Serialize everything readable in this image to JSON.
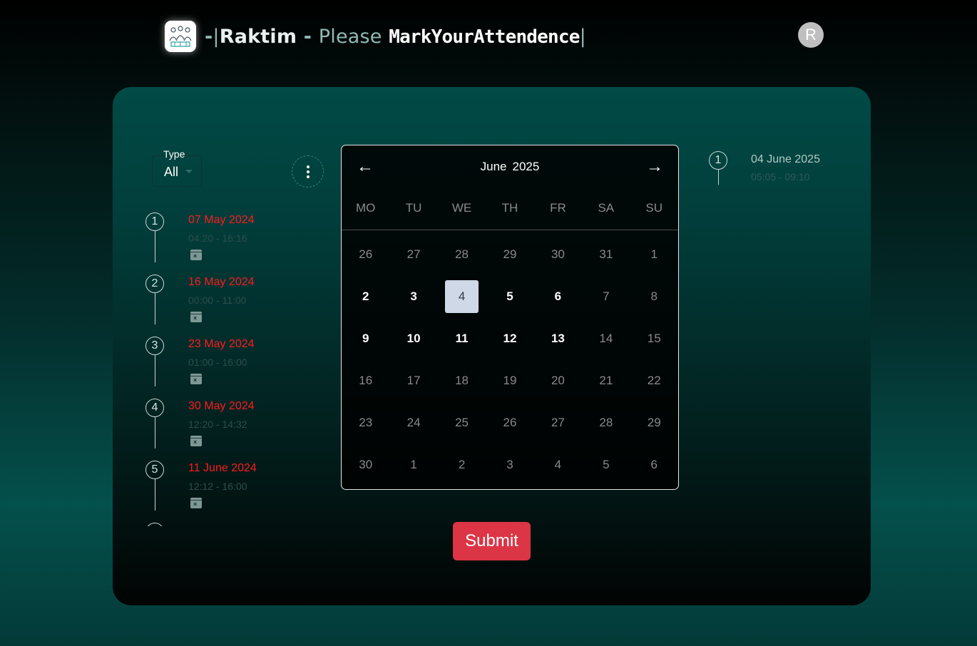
{
  "header": {
    "logo_icon": "team-attendance-icon",
    "title_dash": "-",
    "title_bar_open": "|",
    "user_name": "Raktim",
    "separator": " - ",
    "please": "Please",
    "mark": "MarkYourAttendence",
    "title_bar_close": "|",
    "avatar_initial": "R"
  },
  "filter": {
    "label": "Type",
    "value": "All",
    "caret_icon": "caret-down-icon",
    "more_icon": "vertical-dots-icon"
  },
  "timeline": [
    {
      "index": "1",
      "date": "07 May 2024",
      "time": "04:20 - 16:16",
      "icon": "calendar-x-icon"
    },
    {
      "index": "2",
      "date": "16 May 2024",
      "time": "00:00 - 11:00",
      "icon": "calendar-x-icon"
    },
    {
      "index": "3",
      "date": "23 May 2024",
      "time": "01:00 - 16:00",
      "icon": "calendar-x-icon"
    },
    {
      "index": "4",
      "date": "30 May 2024",
      "time": "12:20 - 14:32",
      "icon": "calendar-x-icon"
    },
    {
      "index": "5",
      "date": "11 June 2024",
      "time": "12:12 - 16:00",
      "icon": "calendar-x-icon"
    }
  ],
  "calendar": {
    "prev": "←",
    "next": "→",
    "month": "June",
    "year": "2025",
    "weekdays": [
      "MO",
      "TU",
      "WE",
      "TH",
      "FR",
      "SA",
      "SU"
    ],
    "weeks": [
      [
        {
          "d": "26",
          "s": "muted"
        },
        {
          "d": "27",
          "s": "muted"
        },
        {
          "d": "28",
          "s": "muted"
        },
        {
          "d": "29",
          "s": "muted"
        },
        {
          "d": "30",
          "s": "muted"
        },
        {
          "d": "31",
          "s": "muted"
        },
        {
          "d": "1",
          "s": "muted"
        }
      ],
      [
        {
          "d": "2",
          "s": "active"
        },
        {
          "d": "3",
          "s": "active"
        },
        {
          "d": "4",
          "s": "selected"
        },
        {
          "d": "5",
          "s": "active"
        },
        {
          "d": "6",
          "s": "active"
        },
        {
          "d": "7",
          "s": "muted"
        },
        {
          "d": "8",
          "s": "muted"
        }
      ],
      [
        {
          "d": "9",
          "s": "active"
        },
        {
          "d": "10",
          "s": "active"
        },
        {
          "d": "11",
          "s": "active"
        },
        {
          "d": "12",
          "s": "active"
        },
        {
          "d": "13",
          "s": "active"
        },
        {
          "d": "14",
          "s": "muted"
        },
        {
          "d": "15",
          "s": "muted"
        }
      ],
      [
        {
          "d": "16",
          "s": "muted"
        },
        {
          "d": "17",
          "s": "muted"
        },
        {
          "d": "18",
          "s": "muted"
        },
        {
          "d": "19",
          "s": "muted"
        },
        {
          "d": "20",
          "s": "muted"
        },
        {
          "d": "21",
          "s": "muted"
        },
        {
          "d": "22",
          "s": "muted"
        }
      ],
      [
        {
          "d": "23",
          "s": "muted"
        },
        {
          "d": "24",
          "s": "muted"
        },
        {
          "d": "25",
          "s": "muted"
        },
        {
          "d": "26",
          "s": "muted"
        },
        {
          "d": "27",
          "s": "muted"
        },
        {
          "d": "28",
          "s": "muted"
        },
        {
          "d": "29",
          "s": "muted"
        }
      ],
      [
        {
          "d": "30",
          "s": "muted"
        },
        {
          "d": "1",
          "s": "muted"
        },
        {
          "d": "2",
          "s": "muted"
        },
        {
          "d": "3",
          "s": "muted"
        },
        {
          "d": "4",
          "s": "muted"
        },
        {
          "d": "5",
          "s": "muted"
        },
        {
          "d": "6",
          "s": "muted"
        }
      ]
    ]
  },
  "selected_entry": {
    "index": "1",
    "date": "04 June 2025",
    "time": "05:05 - 09:10"
  },
  "submit_label": "Submit",
  "colors": {
    "accent_red": "#dc3545",
    "date_red": "#ff1b1b",
    "selected_day": "#cfd8e6"
  }
}
